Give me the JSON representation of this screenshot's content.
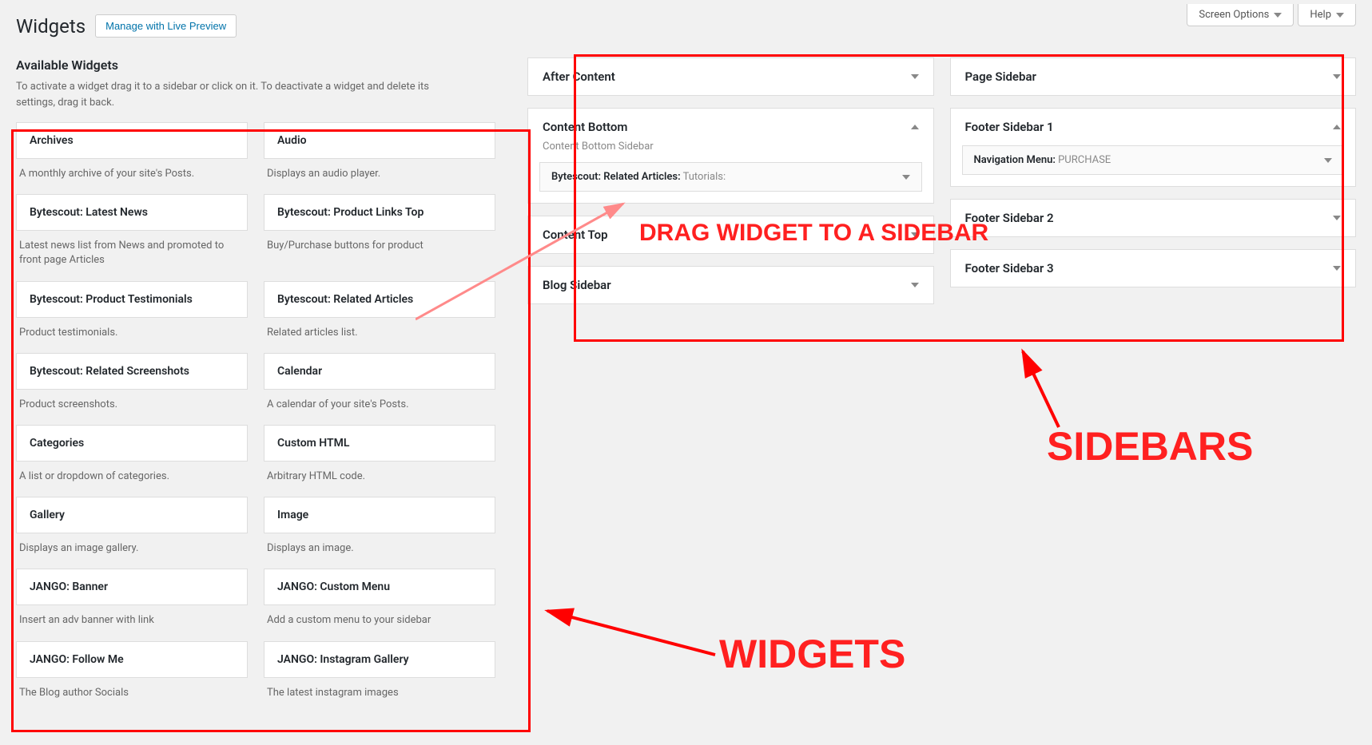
{
  "top": {
    "screen_options": "Screen Options",
    "help": "Help"
  },
  "header": {
    "title": "Widgets",
    "live_preview": "Manage with Live Preview"
  },
  "available": {
    "title": "Available Widgets",
    "desc": "To activate a widget drag it to a sidebar or click on it. To deactivate a widget and delete its settings, drag it back."
  },
  "widgets_left": [
    {
      "name": "Archives",
      "desc": "A monthly archive of your site's Posts."
    },
    {
      "name": "Bytescout: Latest News",
      "desc": "Latest news list from News and promoted to front page Articles"
    },
    {
      "name": "Bytescout: Product Testimonials",
      "desc": "Product testimonials."
    },
    {
      "name": "Bytescout: Related Screenshots",
      "desc": "Product screenshots."
    },
    {
      "name": "Categories",
      "desc": "A list or dropdown of categories."
    },
    {
      "name": "Gallery",
      "desc": "Displays an image gallery."
    },
    {
      "name": "JANGO: Banner",
      "desc": "Insert an adv banner with link"
    },
    {
      "name": "JANGO: Follow Me",
      "desc": "The Blog author Socials"
    }
  ],
  "widgets_right": [
    {
      "name": "Audio",
      "desc": "Displays an audio player."
    },
    {
      "name": "Bytescout: Product Links Top",
      "desc": "Buy/Purchase buttons for product"
    },
    {
      "name": "Bytescout: Related Articles",
      "desc": "Related articles list."
    },
    {
      "name": "Calendar",
      "desc": "A calendar of your site's Posts."
    },
    {
      "name": "Custom HTML",
      "desc": "Arbitrary HTML code."
    },
    {
      "name": "Image",
      "desc": "Displays an image."
    },
    {
      "name": "JANGO: Custom Menu",
      "desc": "Add a custom menu to your sidebar"
    },
    {
      "name": "JANGO: Instagram Gallery",
      "desc": "The latest instagram images"
    }
  ],
  "sidebars_colA": {
    "after_content": "After Content",
    "content_bottom": "Content Bottom",
    "content_bottom_sub": "Content Bottom Sidebar",
    "content_bottom_widget_prefix": "Bytescout: Related Articles:",
    "content_bottom_widget_suffix": " Tutorials:",
    "content_top": "Content Top",
    "blog_sidebar": "Blog Sidebar"
  },
  "sidebars_colB": {
    "page_sidebar": "Page Sidebar",
    "footer1": "Footer Sidebar 1",
    "footer1_widget_prefix": "Navigation Menu:",
    "footer1_widget_suffix": " PURCHASE",
    "footer2": "Footer Sidebar 2",
    "footer3": "Footer Sidebar 3"
  },
  "annotations": {
    "drag": "DRAG WIDGET TO A SIDEBAR",
    "widgets": "WIDGETS",
    "sidebars": "SIDEBARS"
  }
}
